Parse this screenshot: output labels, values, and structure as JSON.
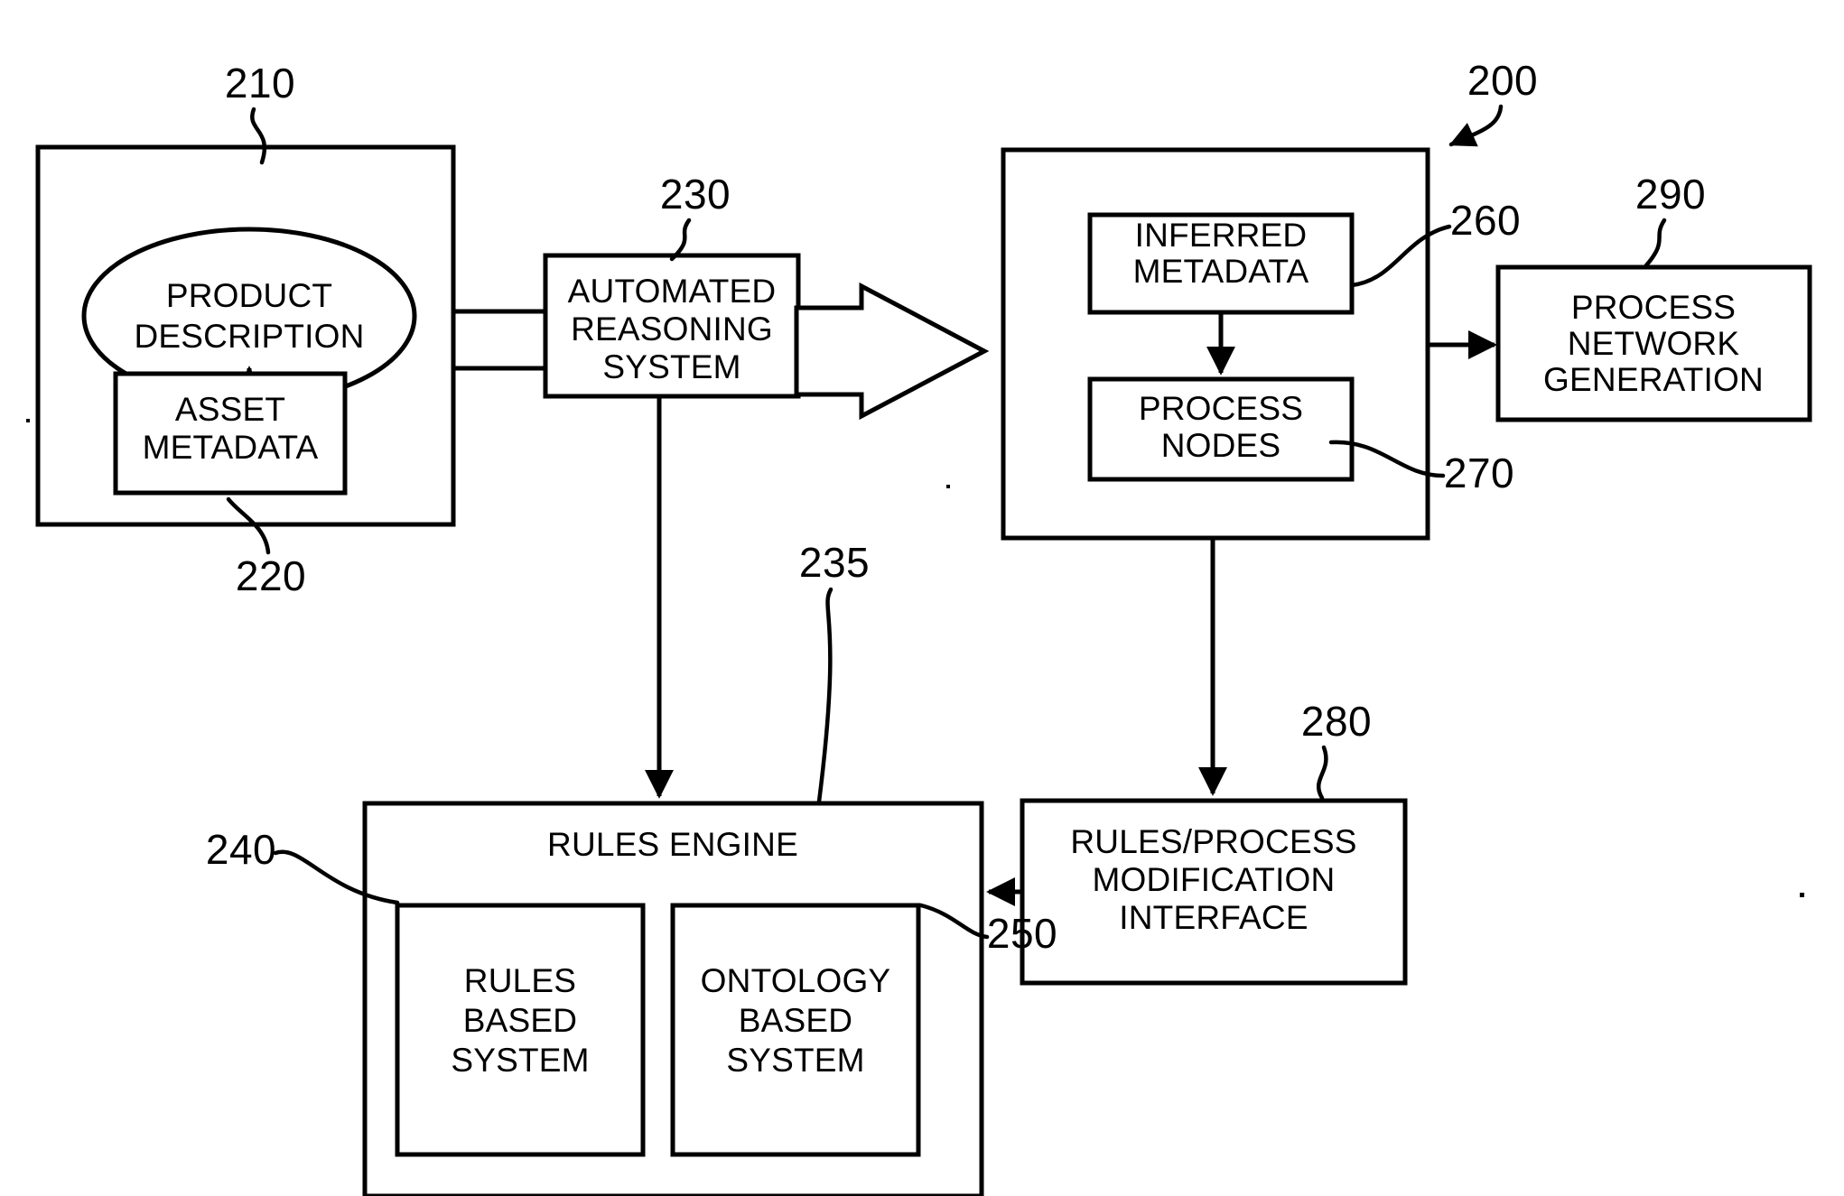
{
  "figure": {
    "type": "patent-block-diagram",
    "background_color": "#ffffff",
    "line_color": "#000000"
  },
  "nodes": {
    "product_description": {
      "label_line1": "PRODUCT",
      "label_line2": "DESCRIPTION",
      "shape": "ellipse"
    },
    "asset_metadata": {
      "label_line1": "ASSET",
      "label_line2": "METADATA",
      "shape": "rectangle"
    },
    "automated_reasoning_system": {
      "label_line1": "AUTOMATED",
      "label_line2": "REASONING",
      "label_line3": "SYSTEM",
      "shape": "rectangle"
    },
    "inferred_metadata": {
      "label_line1": "INFERRED",
      "label_line2": "METADATA",
      "shape": "rectangle"
    },
    "process_nodes": {
      "label_line1": "PROCESS",
      "label_line2": "NODES",
      "shape": "rectangle"
    },
    "process_network_generation": {
      "label_line1": "PROCESS",
      "label_line2": "NETWORK",
      "label_line3": "GENERATION",
      "shape": "rectangle"
    },
    "rules_engine": {
      "label": "RULES ENGINE",
      "shape": "rectangle"
    },
    "rules_based_system": {
      "label_line1": "RULES",
      "label_line2": "BASED",
      "label_line3": "SYSTEM",
      "shape": "rectangle"
    },
    "ontology_based_system": {
      "label_line1": "ONTOLOGY",
      "label_line2": "BASED",
      "label_line3": "SYSTEM",
      "shape": "rectangle"
    },
    "rules_process_modification_interface": {
      "label_line1": "RULES/PROCESS",
      "label_line2": "MODIFICATION",
      "label_line3": "INTERFACE",
      "shape": "rectangle"
    }
  },
  "reference_numerals": {
    "system": "200",
    "product_description_container": "210",
    "asset_metadata": "220",
    "automated_reasoning_system": "230",
    "rules_engine": "235",
    "rules_based_system": "240",
    "ontology_based_system": "250",
    "inferred_metadata": "260",
    "process_nodes": "270",
    "rules_process_modification_interface": "280",
    "process_network_generation": "290"
  }
}
